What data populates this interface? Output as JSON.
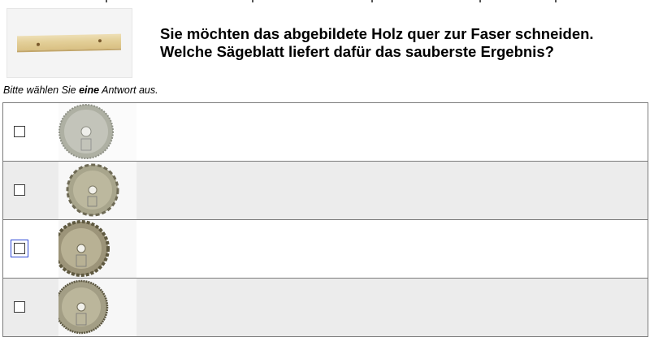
{
  "question": {
    "image_icon": "wood-board-photo",
    "line1": "Sie möchten das abgebildete Holz quer zur Faser schneiden.",
    "line2": "Welche Sägeblatt liefert dafür das sauberste Ergebnis?"
  },
  "instruction": {
    "prefix": "Bitte wählen Sie ",
    "emphasis": "eine",
    "suffix": " Antwort aus."
  },
  "answers": [
    {
      "icon": "saw-blade-fine-teeth-photo",
      "checked": false,
      "focused": false
    },
    {
      "icon": "saw-blade-coarse-teeth-photo",
      "checked": false,
      "focused": false
    },
    {
      "icon": "saw-blade-large-teeth-photo",
      "checked": false,
      "focused": true
    },
    {
      "icon": "saw-blade-flat-teeth-photo",
      "checked": false,
      "focused": false
    }
  ],
  "colors": {
    "row_shade": "#ececec",
    "border": "#7b7b7b",
    "focus_outline": "#2f4ad6",
    "blade_metal": "#b8b59a"
  }
}
